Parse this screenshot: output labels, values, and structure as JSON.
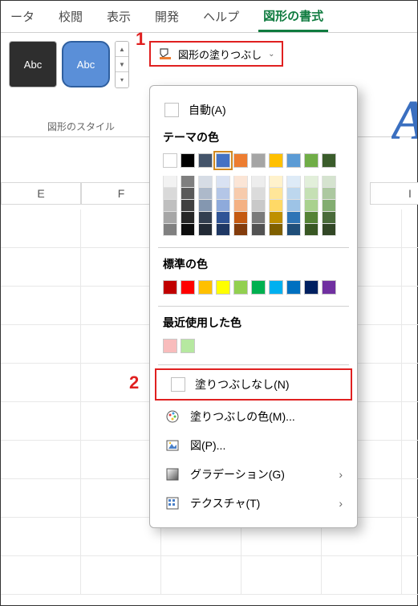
{
  "tabs": {
    "t0": "ータ",
    "t1": "校閲",
    "t2": "表示",
    "t3": "開発",
    "t4": "ヘルプ",
    "t5": "図形の書式"
  },
  "toolbar": {
    "shape_fill_label": "図形の塗りつぶし",
    "group_label": "図形のスタイル",
    "abc": "Abc"
  },
  "callouts": {
    "one": "1",
    "two": "2"
  },
  "columns": {
    "e": "E",
    "f": "F",
    "i": "I"
  },
  "dropdown": {
    "auto": "自動(A)",
    "theme_heading": "テーマの色",
    "standard_heading": "標準の色",
    "recent_heading": "最近使用した色",
    "nofill": "塗りつぶしなし(N)",
    "more_colors": "塗りつぶしの色(M)...",
    "picture": "図(P)...",
    "gradient": "グラデーション(G)",
    "texture": "テクスチャ(T)"
  },
  "theme_colors": [
    "#ffffff",
    "#000000",
    "#44546a",
    "#4472c4",
    "#ed7d31",
    "#a5a5a5",
    "#ffc000",
    "#5b9bd5",
    "#70ad47",
    "#3a5c2b"
  ],
  "theme_shades": [
    [
      "#f2f2f2",
      "#d9d9d9",
      "#bfbfbf",
      "#a6a6a6",
      "#808080"
    ],
    [
      "#7f7f7f",
      "#595959",
      "#404040",
      "#262626",
      "#0d0d0d"
    ],
    [
      "#d6dce5",
      "#adb9ca",
      "#8497b0",
      "#333f50",
      "#222a35"
    ],
    [
      "#d9e2f3",
      "#b4c6e7",
      "#8eaadb",
      "#2f5496",
      "#1f3864"
    ],
    [
      "#fbe5d6",
      "#f7cbac",
      "#f4b183",
      "#c55a11",
      "#833c0c"
    ],
    [
      "#ededed",
      "#dbdbdb",
      "#c9c9c9",
      "#7b7b7b",
      "#525252"
    ],
    [
      "#fff2cc",
      "#ffe699",
      "#ffd966",
      "#bf9000",
      "#806000"
    ],
    [
      "#deebf7",
      "#bdd7ee",
      "#9dc3e6",
      "#2e75b6",
      "#1f4e79"
    ],
    [
      "#e2efda",
      "#c5e0b4",
      "#a9d18e",
      "#548235",
      "#385723"
    ],
    [
      "#d5e3cf",
      "#acc8a0",
      "#83ad71",
      "#4a6b3a",
      "#324726"
    ]
  ],
  "standard_colors": [
    "#c00000",
    "#ff0000",
    "#ffc000",
    "#ffff00",
    "#92d050",
    "#00b050",
    "#00b0f0",
    "#0070c0",
    "#002060",
    "#7030a0"
  ],
  "recent_colors": [
    "#f8bcbc",
    "#b6e8a0"
  ]
}
